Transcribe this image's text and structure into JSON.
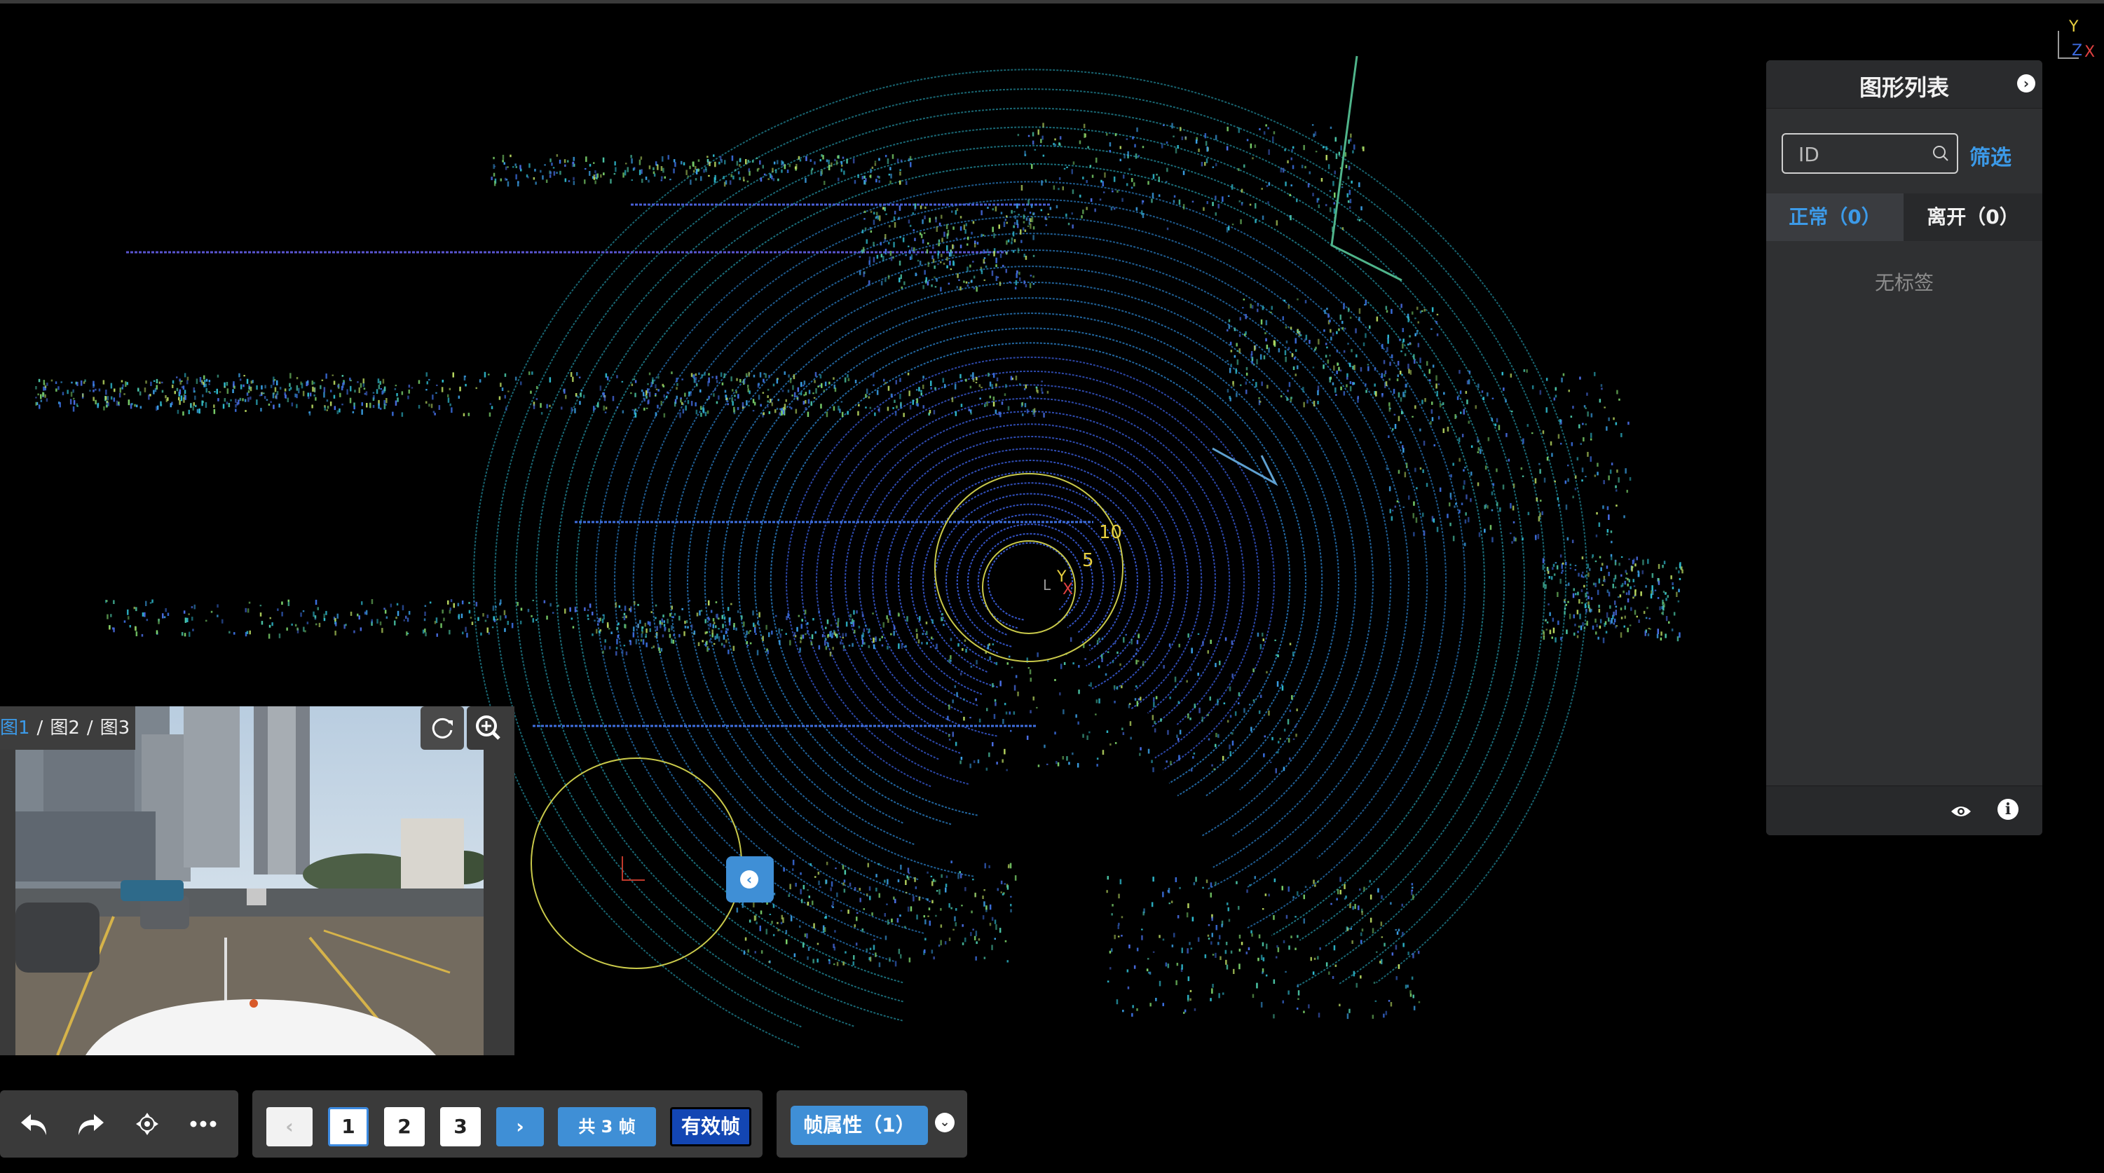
{
  "axis_corner": {
    "y": "Y",
    "z": "Z",
    "x": "X"
  },
  "scene": {
    "ring_labels": [
      "10",
      "5"
    ],
    "ego_axis": {
      "y": "Y",
      "x": "X",
      "z": "L"
    }
  },
  "panel": {
    "title": "图形列表",
    "search_placeholder": "ID",
    "filter_label": "筛选",
    "tabs": [
      {
        "label": "正常（0）"
      },
      {
        "label": "离开（0）"
      }
    ],
    "empty_text": "无标签"
  },
  "camera": {
    "tabs": [
      "图1",
      "图2",
      "图3"
    ],
    "active_tab": "图1"
  },
  "pager": {
    "pages": [
      "1",
      "2",
      "3"
    ],
    "active_page": "1",
    "total_label": "共 3 帧",
    "valid_label": "有效帧"
  },
  "frame_attr": {
    "label": "帧属性（1）"
  },
  "colors": {
    "accent": "#3f8fd6",
    "panel_bg": "#2f3032",
    "valid": "#1346b3"
  }
}
